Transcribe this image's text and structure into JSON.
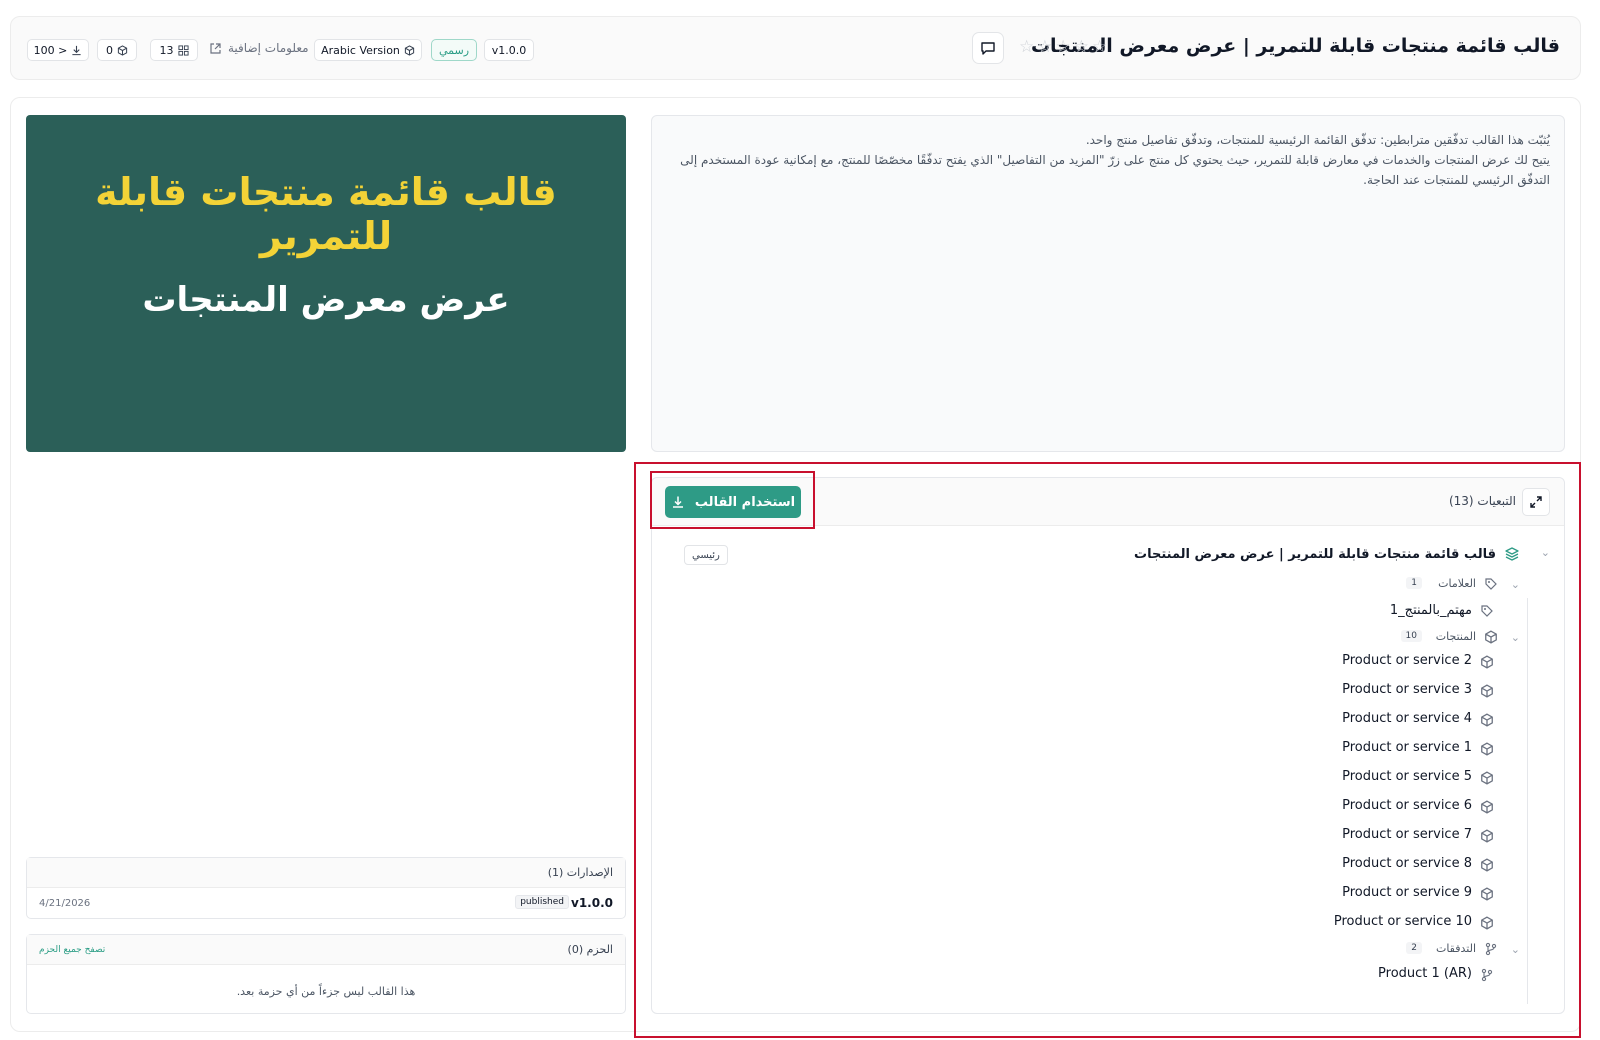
{
  "header": {
    "title": "قالب قائمة منتجات قابلة للتمرير | عرض معرض المنتجات",
    "rating_stars": 5,
    "rating_value": 0,
    "version": "v1.0.0",
    "official_label": "رسمي",
    "language": "Arabic Version",
    "extra_info": "معلومات إضافية",
    "items_count": "13",
    "packages_count": "0",
    "downloads": "100 >"
  },
  "hero": {
    "title": "قالب قائمة منتجات قابلة للتمرير",
    "subtitle": "عرض معرض المنتجات",
    "background_color": "#2b5f58",
    "title_color": "#f3d337"
  },
  "description": {
    "line1": "يُثبّت هذا القالب تدفّقين مترابطين: تدفّق القائمة الرئيسية للمنتجات، وتدفّق تفاصيل منتج واحد.",
    "line2": "يتيح لك عرض المنتجات والخدمات في معارض قابلة للتمرير، حيث يحتوي كل منتج على زرّ \"المزيد من التفاصيل\" الذي يفتح تدفّقًا مخصّصًا للمنتج، مع إمكانية عودة المستخدم إلى التدفّق الرئيسي للمنتجات عند الحاجة."
  },
  "dependencies": {
    "title": "التبعيات (13)",
    "use_button": "استخدام القالب",
    "root": {
      "title": "قالب قائمة منتجات قابلة للتمرير | عرض معرض المنتجات",
      "badge": "رئيسي"
    },
    "tags": {
      "label": "العلامات",
      "count": "1",
      "items": [
        "مهتم_بالمنتج_1"
      ]
    },
    "products": {
      "label": "المنتجات",
      "count": "10",
      "items": [
        "Product or service 2",
        "Product or service 3",
        "Product or service 4",
        "Product or service 1",
        "Product or service 5",
        "Product or service 6",
        "Product or service 7",
        "Product or service 8",
        "Product or service 9",
        "Product or service 10"
      ]
    },
    "flows": {
      "label": "التدفقات",
      "count": "2",
      "items": [
        "Product 1 (AR)"
      ]
    }
  },
  "versions": {
    "title": "الإصدارات (1)",
    "items": [
      {
        "name": "v1.0.0",
        "status": "published",
        "date": "4/21/2026"
      }
    ]
  },
  "packs": {
    "title": "الحزم (0)",
    "browse_link": "تصفح جميع الحزم",
    "empty_text": "هذا القالب ليس جزءاً من أي حزمة بعد."
  },
  "colors": {
    "accent": "#2e9b86",
    "highlight": "#c8102e"
  }
}
